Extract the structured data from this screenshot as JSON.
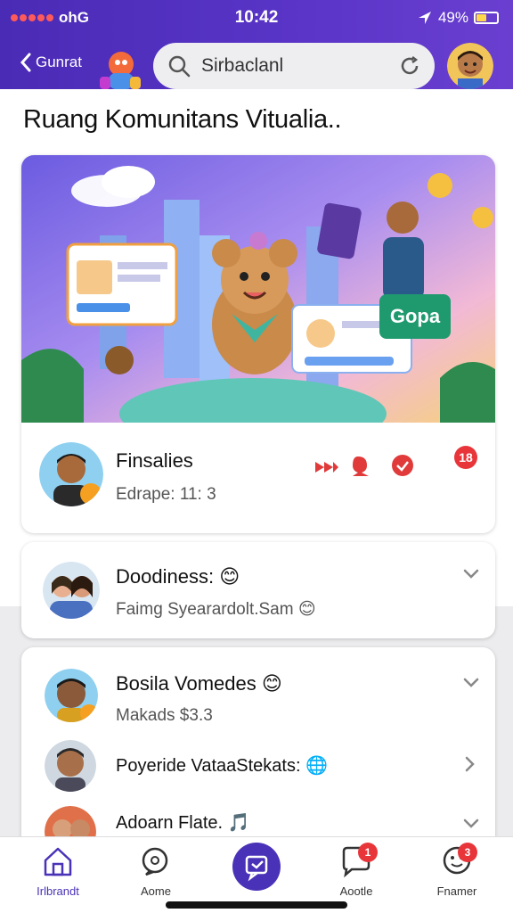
{
  "status": {
    "carrier": "ohG",
    "time": "10:42",
    "battery": "49%",
    "battery_level": 0.49
  },
  "header": {
    "back_label": "Gunrat",
    "search_placeholder": "Sirbaclanl"
  },
  "page_title": "Ruang Komunitans Vitualia..",
  "feed": {
    "name": "Finsalies",
    "sub": "Edrape: 11: 3",
    "join_label": "Gopa",
    "join_badge": "18"
  },
  "groups": [
    {
      "name": "Doodiness:",
      "emoji": "😊",
      "sub": "Faimg Syearardolt.Sam",
      "sub_emoji": "😊"
    },
    {
      "name": "Bosila Vomedes",
      "emoji": "😊",
      "sub": "Makads $3.3"
    },
    {
      "name": "Poyeride VataaStekats:",
      "emoji": "🌐"
    },
    {
      "name": "Adoarn Flate.",
      "emoji": "🎵"
    }
  ],
  "nav": [
    {
      "label": "Irlbrandt",
      "icon": "home-icon"
    },
    {
      "label": "Aome",
      "icon": "search-chat-icon"
    },
    {
      "label": "",
      "icon": "compose-icon"
    },
    {
      "label": "Aootle",
      "icon": "chat-bubble-icon",
      "badge": "1"
    },
    {
      "label": "Fnamer",
      "icon": "smile-chat-icon",
      "badge": "3"
    }
  ],
  "colors": {
    "header": "#4a2bb5",
    "accent": "#4a32b8",
    "join": "#1f9a6f",
    "badge": "#e8353a"
  }
}
